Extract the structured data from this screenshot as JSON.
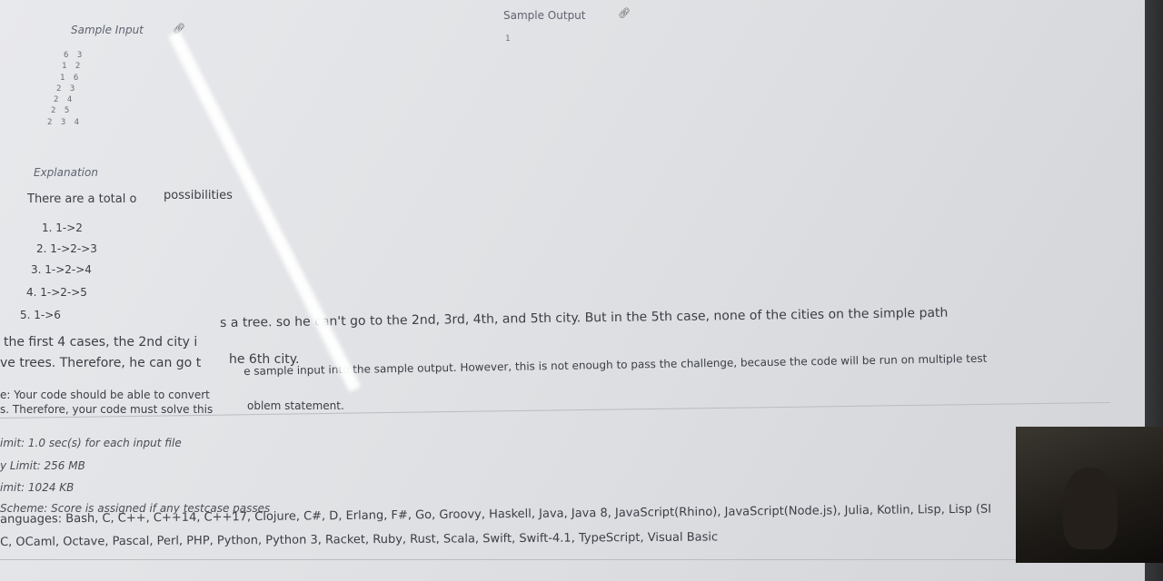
{
  "sample_input": {
    "label": "Sample Input",
    "lines": [
      "6 3",
      "1 2",
      "1 6",
      "2 3",
      "2 4",
      "2 5",
      "2 3 4"
    ]
  },
  "sample_output": {
    "label": "Sample Output",
    "value": "1"
  },
  "explanation": {
    "heading": "Explanation",
    "intro": "There are a total o",
    "intro_tail": "possibilities",
    "items": [
      "1. 1->2",
      "2. 1->2->3",
      "3. 1->2->4",
      "4. 1->2->5",
      "5. 1->6"
    ],
    "para1_line1": "the first 4 cases, the 2nd city i",
    "para1_line1_tail": "s a tree. so he can't go to the 2nd, 3rd, 4th, and 5th city. But in the 5th case, none of the cities on the simple path",
    "para1_line2": "ve trees. Therefore, he can go t",
    "para1_line2_tail": "he 6th city.",
    "note_line1": "e: Your code should be able to convert",
    "note_line1_tail": "e sample input into the sample output. However, this is not enough to pass the challenge, because the code will be run on multiple test",
    "note_line2": "s. Therefore, your code must solve this",
    "note_line2_tail": "oblem statement."
  },
  "limits": {
    "time": "imit: 1.0 sec(s) for each input file",
    "memory": "y Limit: 256 MB",
    "source": "imit: 1024 KB",
    "scoring": "Scheme: Score is assigned if any testcase passes"
  },
  "languages": {
    "line1": "anguages: Bash, C, C++, C++14, C++17, Clojure, C#, D, Erlang, F#, Go, Groovy, Haskell, Java, Java 8, JavaScript(Rhino), JavaScript(Node.js), Julia, Kotlin, Lisp, Lisp (SI",
    "line2": "C, OCaml, Octave, Pascal, Perl, PHP, Python, Python 3, Racket, Ruby, Rust, Scala, Swift, Swift-4.1, TypeScript, Visual Basic"
  },
  "icons": {
    "input_link": "link-icon",
    "output_link": "link-icon"
  }
}
